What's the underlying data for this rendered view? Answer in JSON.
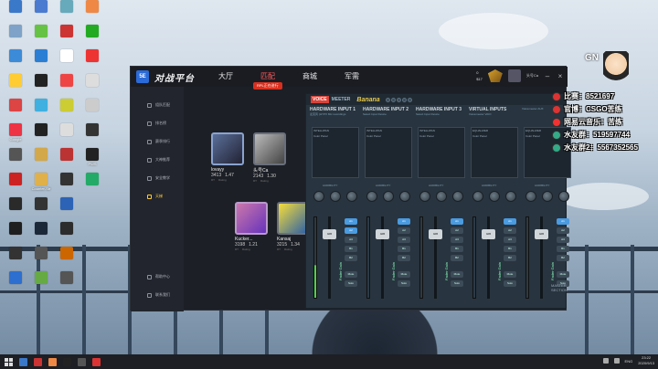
{
  "desktop": {
    "icons_col1": [
      {
        "label": "",
        "color": "#3a78c9"
      },
      {
        "label": "",
        "color": "#7fa2c8"
      },
      {
        "label": "",
        "color": "#3c8bd8"
      },
      {
        "label": "",
        "color": "#ffcc33"
      },
      {
        "label": "",
        "color": "#d44"
      },
      {
        "label": "Google",
        "color": "#e34"
      },
      {
        "label": "",
        "color": "#555"
      },
      {
        "label": "",
        "color": "#c22"
      },
      {
        "label": "",
        "color": "#2a2a2a"
      },
      {
        "label": "",
        "color": "#1f1f1f"
      },
      {
        "label": "",
        "color": "#333"
      },
      {
        "label": "",
        "color": "#2d6fd0"
      }
    ],
    "icons_col2": [
      {
        "label": "",
        "color": "#4a7bd0"
      },
      {
        "label": "",
        "color": "#66c244"
      },
      {
        "label": "",
        "color": "#2a7fd4"
      },
      {
        "label": "",
        "color": "#222"
      },
      {
        "label": "",
        "color": "#3fb0e0"
      },
      {
        "label": "",
        "color": "#222"
      },
      {
        "label": "",
        "color": "#d3a84a"
      },
      {
        "label": "Counter-Str",
        "color": "#e0b04a"
      },
      {
        "label": "",
        "color": "#333"
      },
      {
        "label": "",
        "color": "#1b2838"
      },
      {
        "label": "",
        "color": "#555"
      },
      {
        "label": "",
        "color": "#6a4"
      }
    ],
    "icons_col3": [
      {
        "label": "",
        "color": "#6ab"
      },
      {
        "label": "",
        "color": "#c33"
      },
      {
        "label": "",
        "color": "#fff"
      },
      {
        "label": "",
        "color": "#e44"
      },
      {
        "label": "",
        "color": "#cc3"
      },
      {
        "label": "",
        "color": "#ddd"
      },
      {
        "label": "",
        "color": "#b33"
      },
      {
        "label": "",
        "color": "#333"
      },
      {
        "label": "",
        "color": "#2c63b6"
      },
      {
        "label": "",
        "color": "#2c2c2c"
      },
      {
        "label": "",
        "color": "#c60"
      },
      {
        "label": "",
        "color": "#555"
      }
    ],
    "icons_col4": [
      {
        "label": "",
        "color": "#e84"
      },
      {
        "label": "",
        "color": "#2a2"
      },
      {
        "label": "",
        "color": "#e33"
      },
      {
        "label": "",
        "color": "#ddd"
      },
      {
        "label": "",
        "color": "#ccc"
      },
      {
        "label": "",
        "color": "#333"
      },
      {
        "label": "PWS",
        "color": "#222"
      },
      {
        "label": "",
        "color": "#2a6"
      }
    ]
  },
  "app": {
    "logo": "5E",
    "brand": "对战平台",
    "nav": {
      "hall": "大厅",
      "match": "匹配",
      "mall": "商城",
      "arena": "军需"
    },
    "promo": "RPL正在进行",
    "coins_1": "0",
    "coins_2": "$17",
    "username": "头号Ca",
    "sidebar": [
      "组队匹配",
      "排名榜",
      "赛季排行",
      "大神推荐",
      "安全教学",
      "天梯"
    ],
    "sidebar_bottom": [
      "帮助中心",
      "联系我们"
    ],
    "players": [
      {
        "name": "lovayy",
        "rating": "3413",
        "kd": "1.47",
        "sub1": "RT",
        "sub2": "Rating"
      },
      {
        "name": "头号Ca",
        "rating": "2143",
        "kd": "1.30",
        "sub1": "RT",
        "sub2": "Rating"
      },
      {
        "name": "Kucker...",
        "rating": "3198",
        "kd": "1.21",
        "sub1": "RT",
        "sub2": "Rating"
      },
      {
        "name": "Kansaj",
        "rating": "3215",
        "kd": "1.34",
        "sub1": "RT",
        "sub2": "Rating"
      }
    ]
  },
  "voicemeeter": {
    "brand_voice": "VOICE",
    "brand_meeter": "MEETER",
    "brand_banana": "Banana",
    "strips": [
      {
        "title": "HARDWARE INPUT 1",
        "sub": "麦克风 (HYPX Mic recordings",
        "buses": [
          "A1",
          "A2",
          "A3",
          "B1",
          "B2"
        ]
      },
      {
        "title": "HARDWARE INPUT 2",
        "sub": "Select Input Device",
        "buses": [
          "A1",
          "A2",
          "A3",
          "B1",
          "B2"
        ]
      },
      {
        "title": "HARDWARE INPUT 3",
        "sub": "Select Input Device",
        "buses": [
          "A1",
          "A2",
          "A3",
          "B1",
          "B2"
        ]
      },
      {
        "title": "VIRTUAL INPUTS",
        "sub": "Voicemeeter VAIO",
        "buses": [
          "A1",
          "A2",
          "A3",
          "B1",
          "B2"
        ]
      },
      {
        "title": "",
        "sub": "Voicemeeter AUX",
        "buses": [
          "A1",
          "A2",
          "A3",
          "B1",
          "B2"
        ]
      }
    ],
    "intelli": "INTELLIPAN",
    "equalizer": "EQUALIZER",
    "color_panel": "Color Panel",
    "fader_gain": "Fader Gain",
    "fader_label": "0dB",
    "mute": "Mute",
    "solo": "Solo",
    "comp": "Comp.",
    "audibility": "AUDIBILITY",
    "gate": "Gate",
    "master_section": "MASTER SECTION"
  },
  "overlay": {
    "gn": "GN",
    "lines": [
      {
        "text": "比赛：8521697",
        "color": "#d33"
      },
      {
        "text": "官博：CSGO苦练",
        "color": "#d33"
      },
      {
        "text": "网易云音乐：苦练",
        "color": "#e33"
      },
      {
        "text": "水友群：519597744",
        "color": "#3a8"
      },
      {
        "text": "水友群2：5567352565",
        "color": "#3a8"
      }
    ]
  },
  "taskbar": {
    "lang": "ENG",
    "time": "23:22",
    "date": "2020/9/13",
    "apps": [
      {
        "color": "#3a78c9"
      },
      {
        "color": "#c33"
      },
      {
        "color": "#e84"
      },
      {
        "color": "#222"
      },
      {
        "color": "#555"
      },
      {
        "color": "#d33"
      }
    ]
  }
}
